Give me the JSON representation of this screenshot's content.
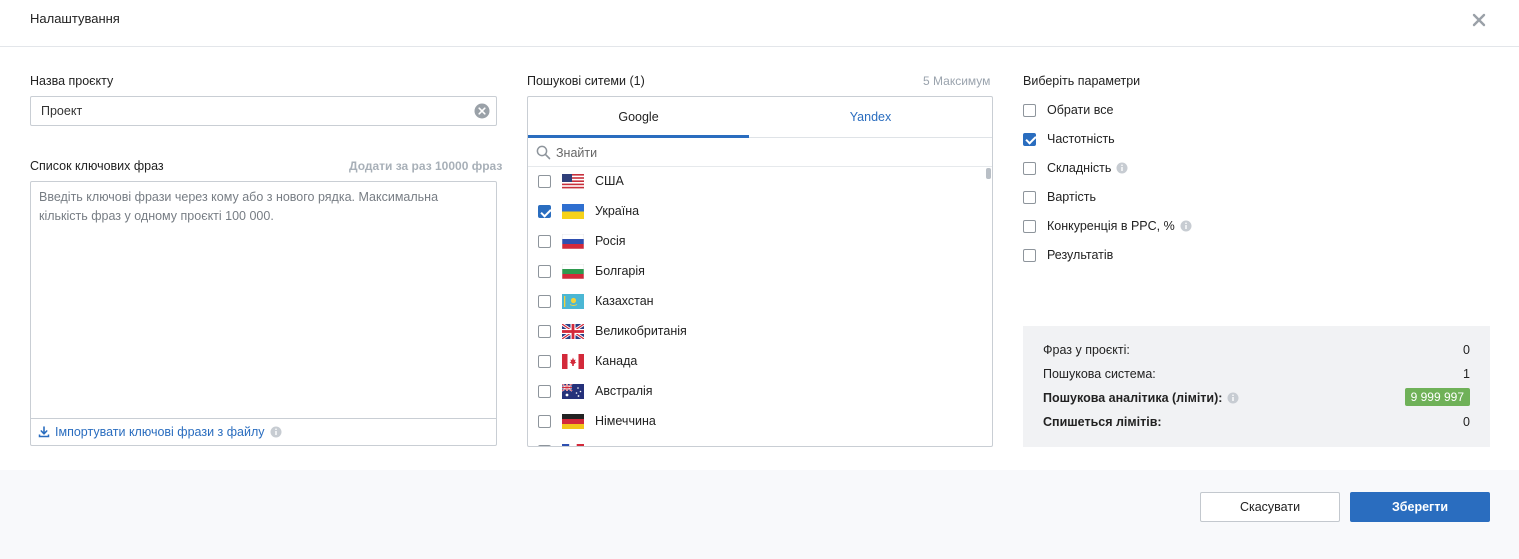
{
  "header": {
    "title": "Налаштування"
  },
  "project": {
    "name_label": "Назва проєкту",
    "name_value": "Проект"
  },
  "phrases": {
    "label": "Список ключових фраз",
    "limit_hint": "Додати за раз 10000 фраз",
    "placeholder": "Введіть ключові фрази через кому або з нового рядка. Максимальна кількість фраз у одному проєкті 100 000.",
    "import_label": "Імпортувати ключові фрази з файлу"
  },
  "search_engines": {
    "label": "Пошукові ситеми (1)",
    "max_hint": "5 Максимум",
    "tabs": [
      {
        "label": "Google",
        "active": true
      },
      {
        "label": "Yandex",
        "active": false
      }
    ],
    "search_placeholder": "Знайти",
    "countries": [
      {
        "name": "США",
        "checked": false,
        "flag": "us-flag-icon"
      },
      {
        "name": "Україна",
        "checked": true,
        "flag": "ua-flag-icon"
      },
      {
        "name": "Росія",
        "checked": false,
        "flag": "ru-flag-icon"
      },
      {
        "name": "Болгарія",
        "checked": false,
        "flag": "bg-flag-icon"
      },
      {
        "name": "Казахстан",
        "checked": false,
        "flag": "kz-flag-icon"
      },
      {
        "name": "Великобританія",
        "checked": false,
        "flag": "gb-flag-icon"
      },
      {
        "name": "Канада",
        "checked": false,
        "flag": "ca-flag-icon"
      },
      {
        "name": "Австралія",
        "checked": false,
        "flag": "au-flag-icon"
      },
      {
        "name": "Німеччина",
        "checked": false,
        "flag": "de-flag-icon"
      }
    ]
  },
  "parameters": {
    "label": "Виберіть параметри",
    "items": [
      {
        "label": "Обрати все",
        "checked": false,
        "info": false
      },
      {
        "label": "Частотність",
        "checked": true,
        "info": false
      },
      {
        "label": "Складність",
        "checked": false,
        "info": true
      },
      {
        "label": "Вартість",
        "checked": false,
        "info": false
      },
      {
        "label": "Конкуренція в PPC, %",
        "checked": false,
        "info": true
      },
      {
        "label": "Результатів",
        "checked": false,
        "info": false
      }
    ]
  },
  "stats": {
    "phrases_in_project_label": "Фраз у проєкті:",
    "phrases_in_project_value": "0",
    "search_system_label": "Пошукова система:",
    "search_system_value": "1",
    "analytics_label": "Пошукова аналітика (ліміти):",
    "analytics_value": "9 999 997",
    "charge_label": "Спишеться лімітів:",
    "charge_value": "0"
  },
  "footer": {
    "cancel_label": "Скасувати",
    "save_label": "Зберегти"
  },
  "colors": {
    "accent": "#2a6dbf",
    "badge_green": "#6fb158",
    "stats_bg": "#f1f2f4"
  }
}
